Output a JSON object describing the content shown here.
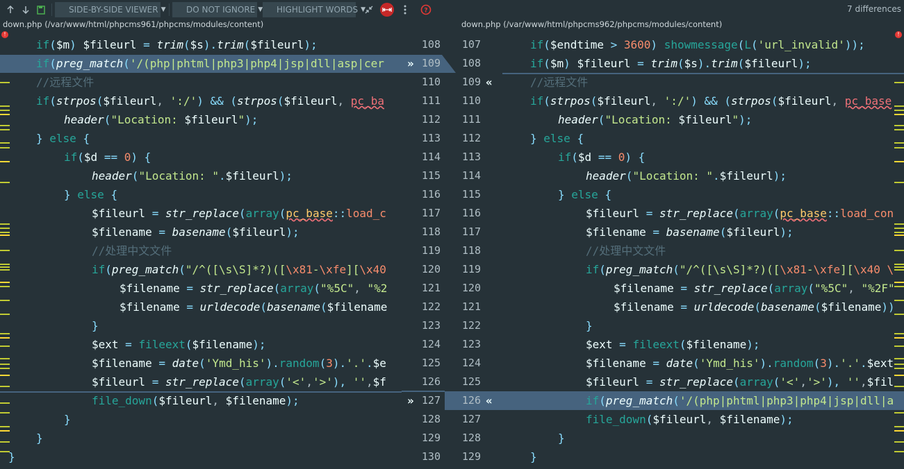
{
  "toolbar": {
    "viewer_label": "SIDE-BY-SIDE VIEWER",
    "ignore_label": "DO NOT IGNORE",
    "highlight_label": "HIGHLIGHT WORDS",
    "differences": "7 differences"
  },
  "left": {
    "path": "down.php (/var/www/html/phpcms961/phpcms/modules/content)",
    "line_numbers": [
      "108",
      "109",
      "110",
      "111",
      "112",
      "113",
      "114",
      "115",
      "116",
      "117",
      "118",
      "119",
      "120",
      "121",
      "122",
      "123",
      "124",
      "125",
      "126",
      "127",
      "128",
      "129",
      "130"
    ]
  },
  "right": {
    "path": "down.php (/var/www/html/phpcms962/phpcms/modules/content)",
    "line_numbers": [
      "107",
      "108",
      "109",
      "110",
      "111",
      "112",
      "113",
      "114",
      "115",
      "116",
      "117",
      "118",
      "119",
      "120",
      "121",
      "122",
      "123",
      "124",
      "125",
      "126",
      "127",
      "128",
      "129"
    ]
  },
  "accent": "#46637e",
  "arrows": {
    "right": "»",
    "left": "«"
  }
}
